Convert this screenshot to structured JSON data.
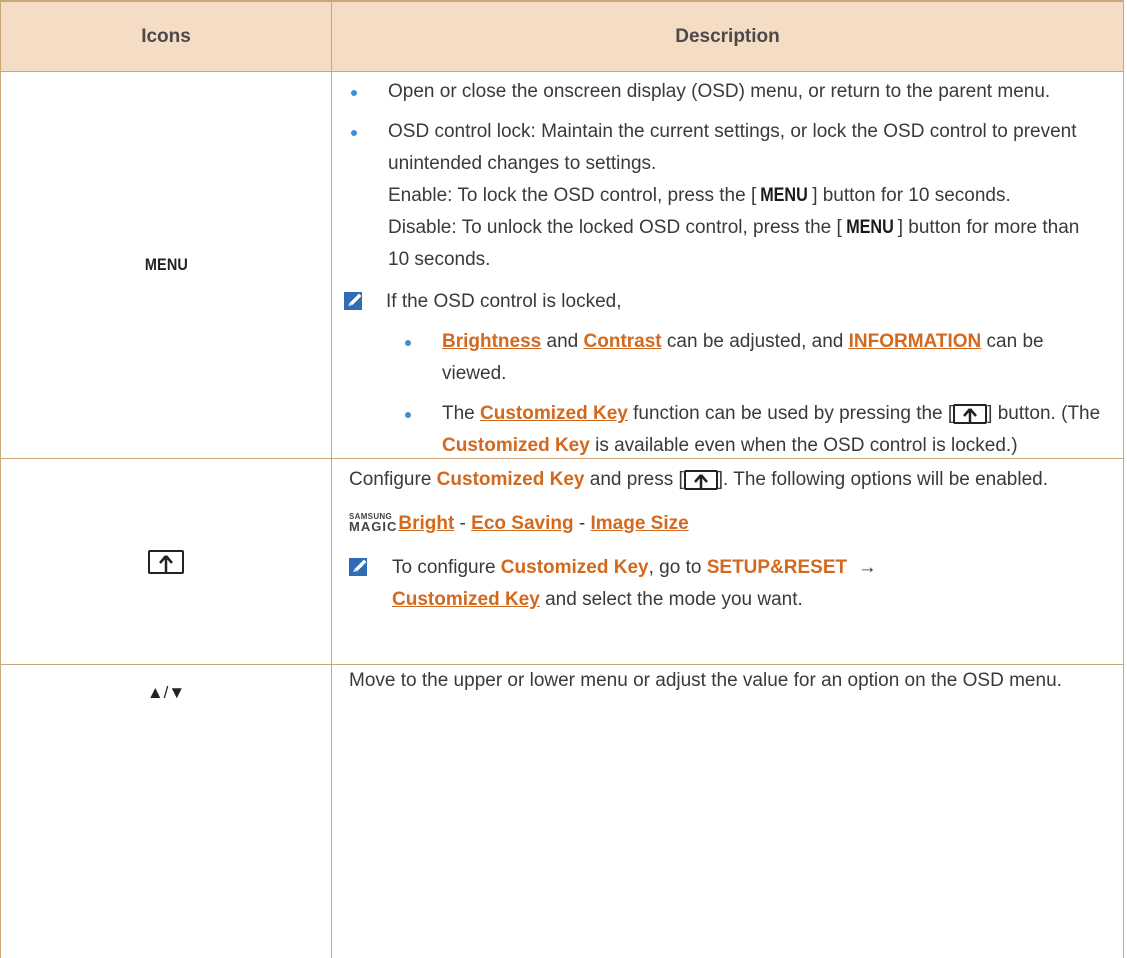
{
  "header": {
    "icons": "Icons",
    "description": "Description"
  },
  "menu_row": {
    "icon_label": "MENU",
    "b1": "Open or close the onscreen display (OSD) menu, or return to the parent menu.",
    "b2_line": "OSD control lock: Maintain the current settings, or lock the OSD control to prevent unintended changes to settings.",
    "enable_pre": "Enable: To lock the OSD control, press the [",
    "menu_key": "MENU",
    "enable_post": "] button for 10 seconds.",
    "disable_pre": "Disable: To unlock the locked OSD control, press the [",
    "disable_post": "] button for more than 10 seconds.",
    "note_intro": "If the OSD control is locked,",
    "n1_brightness": "Brightness",
    "n1_and": " and ",
    "n1_contrast": "Contrast",
    "n1_mid": " can be adjusted, and ",
    "n1_information": "INFORMATION",
    "n1_end": " can be viewed.",
    "n2_pre": "The ",
    "n2_ck": "Customized Key",
    "n2_mid": " function can be used by pressing the [",
    "n2_post": "] button. (The ",
    "n2_ck2": "Customized Key",
    "n2_end": " is available even when the OSD control is locked.)"
  },
  "key_row": {
    "l1_pre": "Configure ",
    "l1_ck": "Customized Key",
    "l1_mid": " and press [",
    "l1_end": "]. The following options will be enabled.",
    "samsung": "SAMSUNG",
    "magic": "MAGIC",
    "bright": "Bright",
    "sep1": " - ",
    "eco": "Eco Saving",
    "sep2": " - ",
    "image": "Image Size",
    "note_pre": "To configure ",
    "note_ck": "Customized Key",
    "note_mid": ", go to ",
    "setup": "SETUP&RESET",
    "arrow": "  →  ",
    "note_ck2": "Customized Key",
    "note_end": " and select the mode you want."
  },
  "arrow_row": {
    "icon_label": "▲/▼",
    "desc": "Move to the upper or lower menu or adjust the value for an option on the OSD menu."
  },
  "colors": {
    "accent": "#d2691e",
    "header_bg": "#f5dcc5",
    "border": "#c9a77a",
    "bullet": "#3f8fd0"
  },
  "icons": {
    "note": "note-pencil-icon",
    "key": "customized-key-icon"
  }
}
